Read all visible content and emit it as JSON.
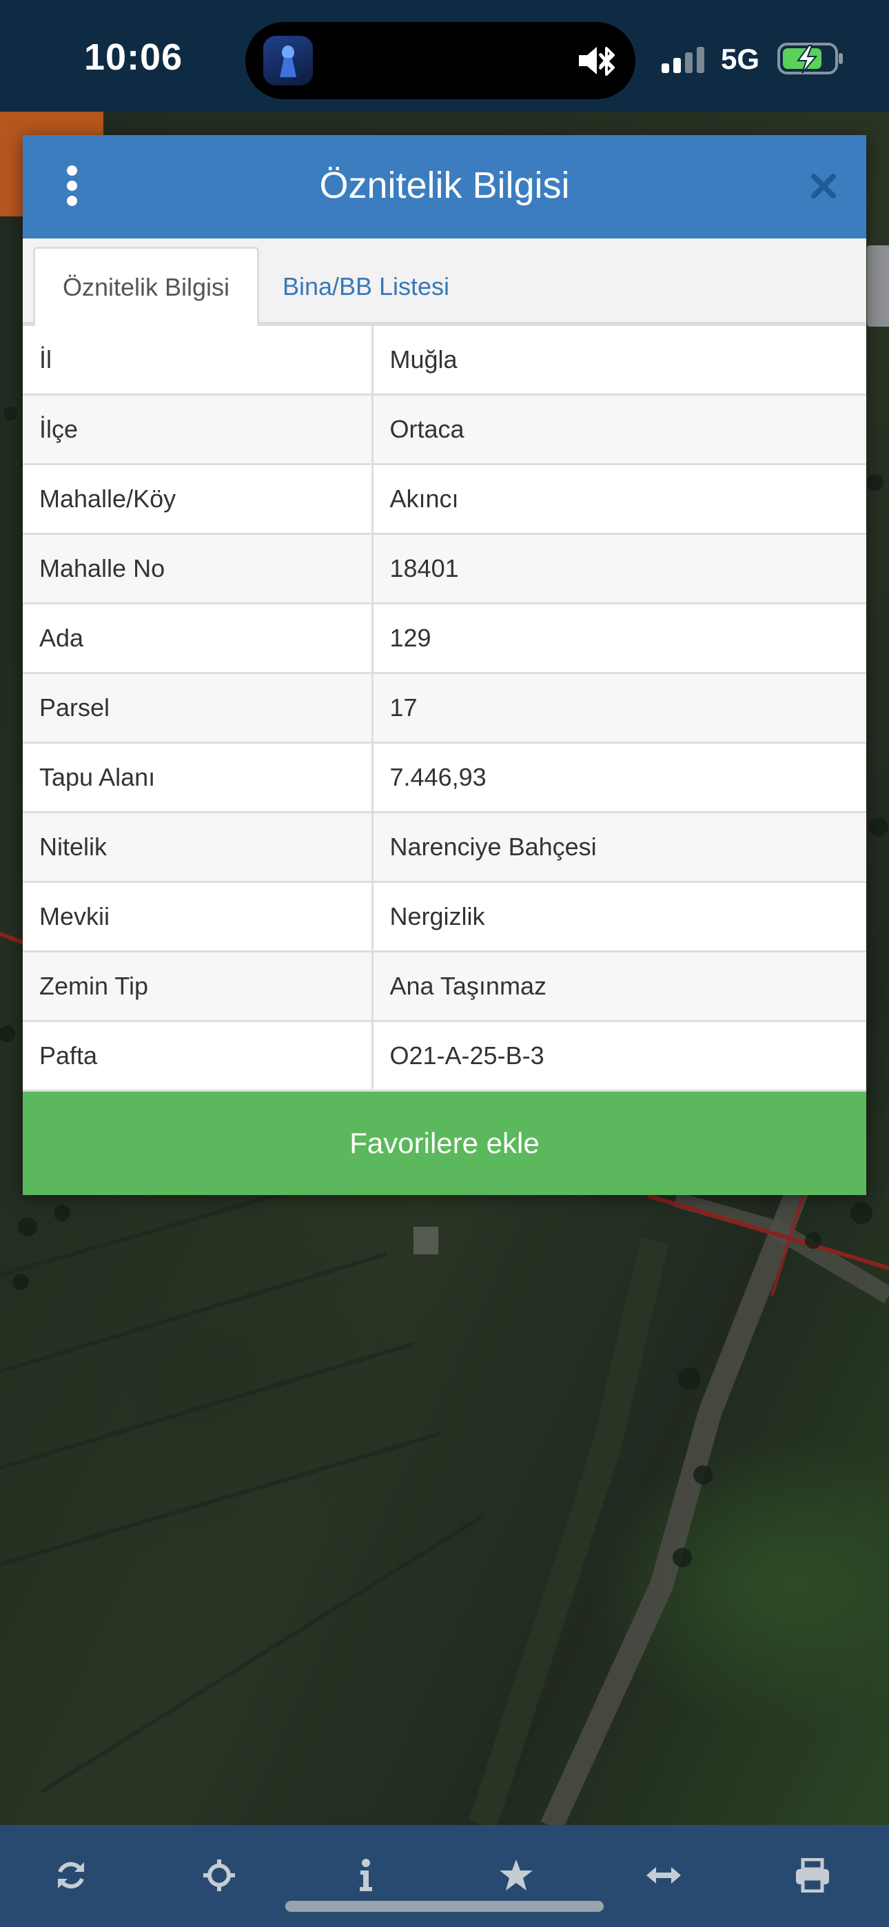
{
  "status_bar": {
    "time": "10:06",
    "network": "5G",
    "icons": [
      "app-icon",
      "mute-icon",
      "bluetooth-icon",
      "signal-icon",
      "battery-charging-icon"
    ]
  },
  "modal": {
    "title": "Öznitelik Bilgisi",
    "tabs": [
      {
        "label": "Öznitelik Bilgisi",
        "active": true
      },
      {
        "label": "Bina/BB Listesi",
        "active": false
      }
    ],
    "rows": [
      {
        "key": "İl",
        "value": "Muğla"
      },
      {
        "key": "İlçe",
        "value": "Ortaca"
      },
      {
        "key": "Mahalle/Köy",
        "value": "Akıncı"
      },
      {
        "key": "Mahalle No",
        "value": "18401"
      },
      {
        "key": "Ada",
        "value": "129"
      },
      {
        "key": "Parsel",
        "value": "17"
      },
      {
        "key": "Tapu Alanı",
        "value": "7.446,93"
      },
      {
        "key": "Nitelik",
        "value": "Narenciye Bahçesi"
      },
      {
        "key": "Mevkii",
        "value": "Nergizlik"
      },
      {
        "key": "Zemin Tip",
        "value": "Ana Taşınmaz"
      },
      {
        "key": "Pafta",
        "value": "O21-A-25-B-3"
      }
    ],
    "favorite_button": "Favorilere ekle"
  },
  "toolbar": {
    "icons": [
      "refresh-icon",
      "locate-icon",
      "info-icon",
      "star-icon",
      "measure-icon",
      "print-icon"
    ]
  },
  "colors": {
    "header_blue": "#3c7dc0",
    "status_bar": "#0f2b44",
    "toolbar": "#284a70",
    "favorite_green": "#5cb85c",
    "tab_link": "#3679b9"
  }
}
